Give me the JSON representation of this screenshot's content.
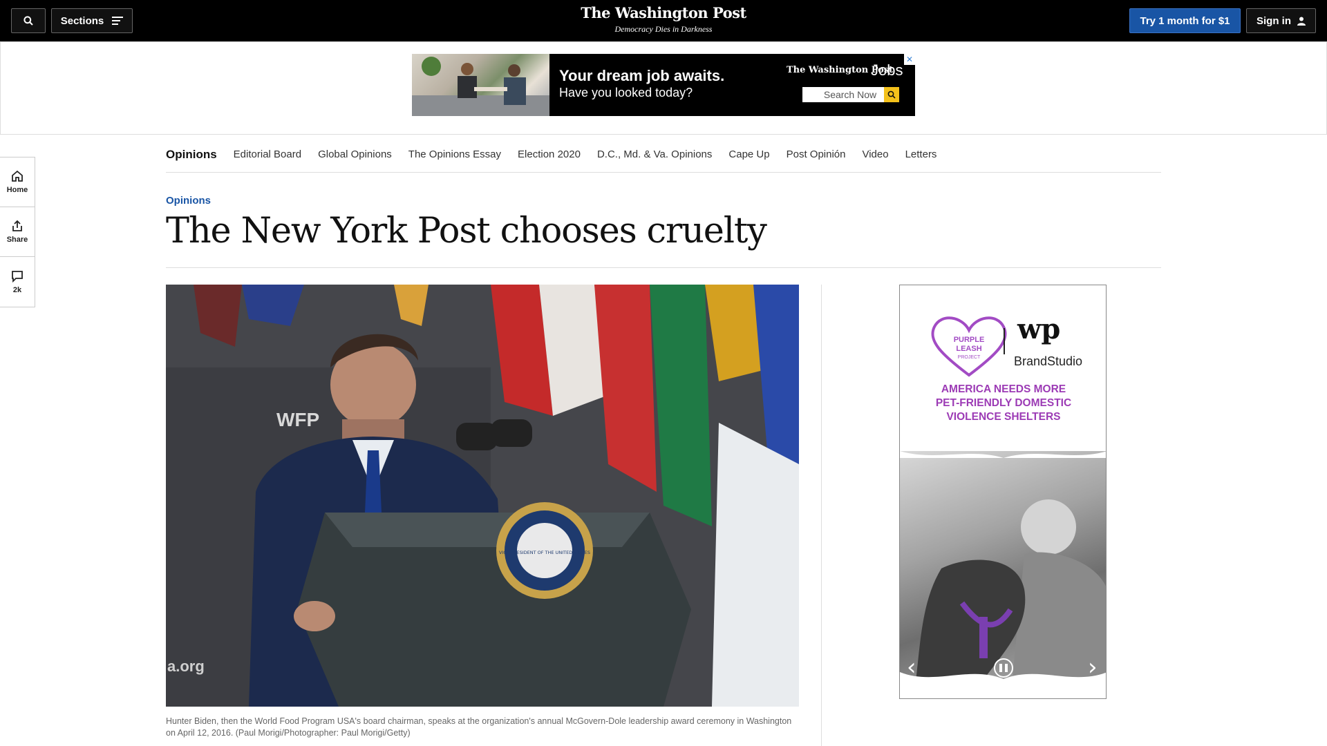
{
  "topbar": {
    "sections_label": "Sections",
    "logo": "The Washington Post",
    "tagline": "Democracy Dies in Darkness",
    "try_label": "Try 1 month for $1",
    "signin_label": "Sign in"
  },
  "top_ad": {
    "headline": "Your dream job awaits.",
    "subline": "Have you looked today?",
    "brand": "The Washington Post",
    "brand_suffix": "Jobs",
    "search_label": "Search Now"
  },
  "section_nav": {
    "label": "Opinions",
    "items": [
      "Editorial Board",
      "Global Opinions",
      "The Opinions Essay",
      "Election 2020",
      "D.C., Md. & Va. Opinions",
      "Cape Up",
      "Post Opinión",
      "Video",
      "Letters"
    ]
  },
  "rail": {
    "home": "Home",
    "share": "Share",
    "comments": "2k"
  },
  "article": {
    "kicker": "Opinions",
    "headline": "The New York Post chooses cruelty",
    "caption": "Hunter Biden, then the World Food Program USA's board chairman, speaks at the organization's annual McGovern-Dole leadership award ceremony in Washington on April 12, 2016. (Paul Morigi/Photographer: Paul Morigi/Getty)"
  },
  "lead_photo": {
    "banner_text": "WFP",
    "seal_text": "VICE PRESIDENT OF THE UNITED STATES",
    "site_text": "a.org"
  },
  "side_ad": {
    "logo_line1": "PURPLE",
    "logo_line2": "LEASH",
    "logo_line3": "PROJECT",
    "brand": "wp",
    "brand_studio": "BrandStudio",
    "copy_line1": "AMERICA NEEDS MORE",
    "copy_line2": "PET-FRIENDLY DOMESTIC",
    "copy_line3": "VIOLENCE SHELTERS"
  },
  "colors": {
    "accent_blue": "#1955a5",
    "ad_purple": "#9c3bb5"
  }
}
